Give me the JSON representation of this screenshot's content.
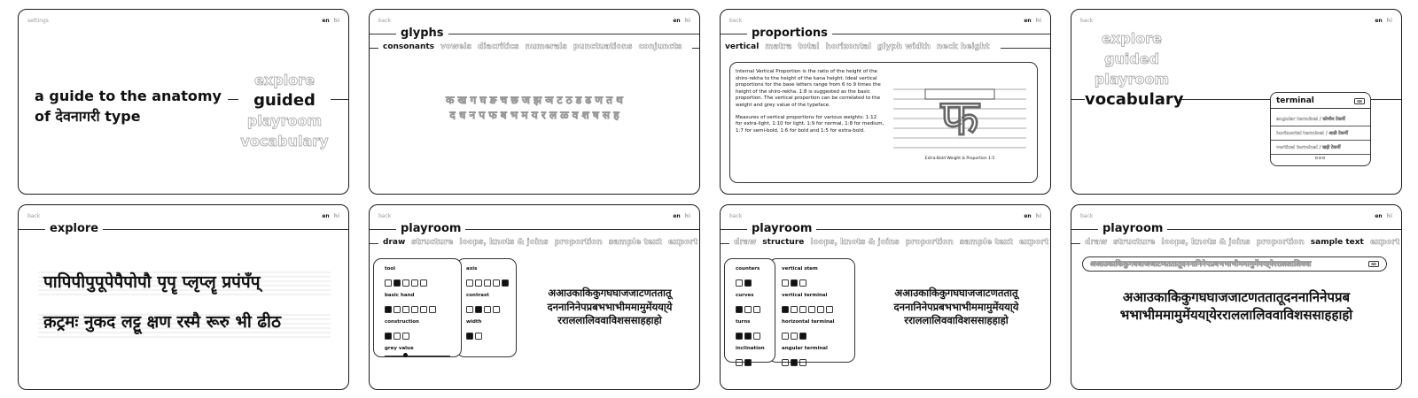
{
  "lang": {
    "en": "en",
    "hi": "hi"
  },
  "s1": {
    "nav": "settings",
    "headline_1": "a guide to the anatomy",
    "headline_2": "of देवनागरी type",
    "menu": [
      "explore",
      "guided",
      "playroom",
      "vocabulary"
    ],
    "active": "guided"
  },
  "s2": {
    "nav": "back",
    "title": "glyphs",
    "tabs": [
      "consonants",
      "vowels",
      "diacritics",
      "numerals",
      "punctuations",
      "conjuncts"
    ],
    "row1": "क ख ग घ ङ च छ ज झ ञ ट ठ ड ढ ण त थ",
    "row2": "द ध न प फ ब भ म य र ल ळ व श ष स ह"
  },
  "s3": {
    "nav": "back",
    "title": "proportions",
    "tabs": [
      "vertical",
      "matra",
      "total",
      "horizontal",
      "glyph width",
      "neck height"
    ],
    "para1": "Internal Vertical Proportion is the ratio of the height of the shiro-rekha to the height of the kana height. Ideal vertical proportions for the base letters range from 6 to 9 times the height of the shiro-rekha. 1:8 is suggested as the basic proportion. The vertical proportion can be correlated to the weight and grey value of the typeface.",
    "para2": "Measures of vertical proportions for various weights: 1:12 for extra-light, 1:10 for light, 1:9 for normal, 1:8 for medium, 1:7 for semi-bold, 1:6 for bold and 1:5 for extra-bold.",
    "glyph": "फ",
    "caption": "Extra-Bold Weight & Proportion 1:5"
  },
  "s4": {
    "nav": "back",
    "menu": [
      "explore",
      "guided",
      "playroom",
      "vocabulary"
    ],
    "active": "vocabulary",
    "search": "terminal",
    "results": [
      "angular terminal / कोणीय टेकर्मी",
      "horizontal terminal / आडी टेकर्मी",
      "vertical terminal / खड़ी टेकर्मी"
    ],
    "more": "ooo"
  },
  "s5": {
    "nav": "back",
    "title": "explore",
    "line1": "पापिपीपुपूपेपैपोपौ पृपॄ प्लृप्लॄ प्रपंपँप्",
    "line2": "क़ट्रमः नुकद लट्टू क्षण रस्मै रूरु भी ढीठ"
  },
  "s6": {
    "nav": "back",
    "title": "playroom",
    "tabs": [
      "draw",
      "structure",
      "loops, knots & joins",
      "proportion",
      "sample text",
      "export"
    ],
    "left_groups": [
      {
        "label": "tool",
        "boxes": [
          false,
          true,
          false,
          false,
          false
        ]
      },
      {
        "label": "basic hand",
        "boxes": [
          true,
          false,
          false,
          false,
          false,
          false
        ]
      },
      {
        "label": "construction",
        "boxes": [
          true,
          false,
          false
        ]
      },
      {
        "label": "grey value",
        "slider": 0.3
      }
    ],
    "right_groups": [
      {
        "label": "axis",
        "boxes": [
          false,
          false,
          false,
          false,
          true
        ]
      },
      {
        "label": "contrast",
        "boxes": [
          false,
          true,
          false,
          false
        ]
      },
      {
        "label": "width",
        "boxes": [
          true,
          false
        ]
      }
    ],
    "sample": [
      "अआउकाकिकुगघघाजजाटणततातू",
      "दननानिनेपप्रबभभाभीममामुमेंयया्ये",
      "रराललालिववाविशससाहहाहो"
    ]
  },
  "s7": {
    "nav": "back",
    "title": "playroom",
    "tabs": [
      "draw",
      "structure",
      "loops, knots & joins",
      "proportion",
      "sample text",
      "export"
    ],
    "left_groups": [
      {
        "label": "counters",
        "boxes": [
          false,
          true
        ]
      },
      {
        "label": "curves",
        "boxes": [
          true,
          false,
          false
        ]
      },
      {
        "label": "turns",
        "boxes": [
          true,
          true,
          false
        ]
      },
      {
        "label": "inclination",
        "boxes": [
          false,
          true
        ]
      }
    ],
    "right_groups": [
      {
        "label": "vertical stem",
        "boxes": [
          false,
          true,
          false
        ]
      },
      {
        "label": "vertical terminal",
        "boxes": [
          true,
          false,
          false,
          false,
          false,
          false
        ]
      },
      {
        "label": "horizontal terminal",
        "boxes": [
          false,
          false,
          true
        ]
      },
      {
        "label": "angular terminal",
        "boxes": [
          false,
          true,
          false
        ]
      }
    ],
    "sample": [
      "अआउकाकिकुगघघाजजाटणततातू",
      "दननानिनेपप्रबभभाभीममामुमेंयया्ये",
      "रराललालिववाविशससाहहाहो"
    ]
  },
  "s8": {
    "nav": "back",
    "title": "playroom",
    "tabs": [
      "draw",
      "structure",
      "loops, knots & joins",
      "proportion",
      "sample text",
      "export"
    ],
    "input": "अआउकाकिकुगघघाजजाटणततातूदननानिनेपप्रबभभाभीममामुमेंयया्येरराललालिववा",
    "sample": [
      "अआउकाकिकुगघघाजजाटणततातूदननानिनेपप्रब",
      "भभाभीममामुमेंयया्येरराललालिववाविशससाहहाहो"
    ]
  },
  "colors": {
    "ink": "#111111",
    "outline": "#999999",
    "frame": "#1a1a1a"
  }
}
